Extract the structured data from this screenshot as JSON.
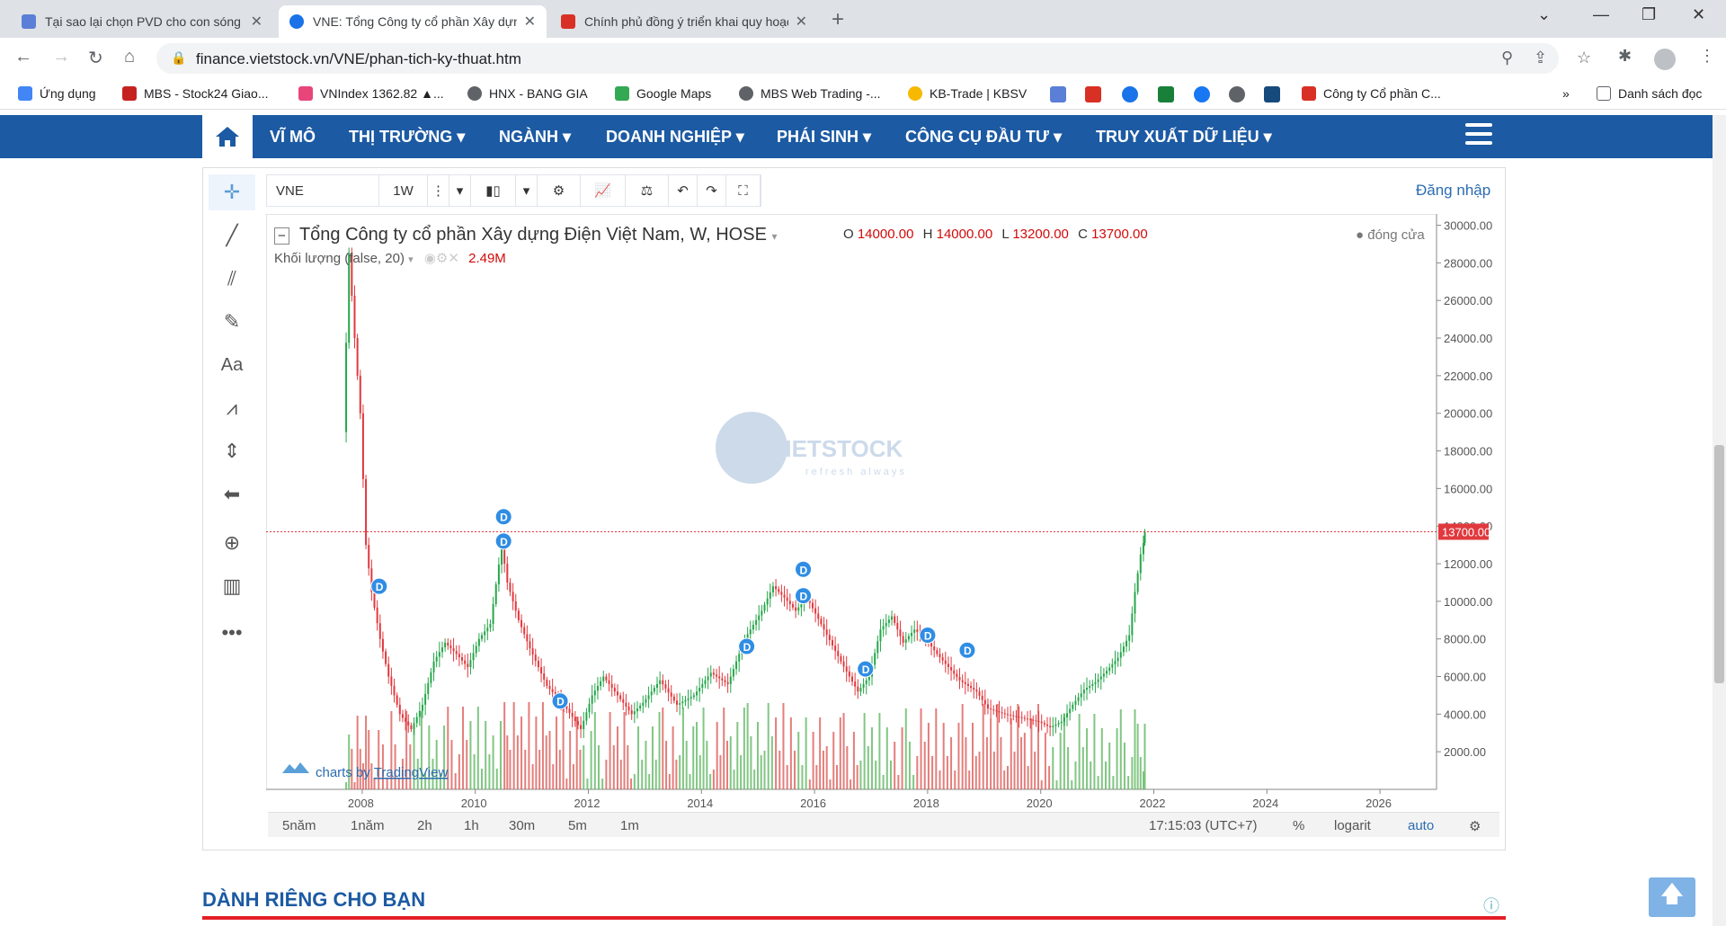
{
  "browser": {
    "tabs": [
      {
        "title": "Tại sao lại chọn PVD cho con sóng",
        "color": "#5b7fd6"
      },
      {
        "title": "VNE: Tổng Công ty cổ phần Xây dựng",
        "color": "#1a73e8",
        "active": true
      },
      {
        "title": "Chính phủ đồng ý triển khai quy hoạch",
        "color": "#d93025"
      }
    ],
    "url": "finance.vietstock.vn/VNE/phan-tich-ky-thuat.htm",
    "bookmarks": [
      {
        "label": "Ứng dụng",
        "color": "#4285f4"
      },
      {
        "label": "MBS - Stock24 Giao...",
        "color": "#c5221f"
      },
      {
        "label": "VNIndex 1362.82 ▲...",
        "color": "#e8457a"
      },
      {
        "label": "HNX - BANG GIA",
        "color": "#5f6368"
      },
      {
        "label": "Google Maps",
        "color": "#34a853"
      },
      {
        "label": "MBS Web Trading -...",
        "color": "#5f6368"
      },
      {
        "label": "KB-Trade | KBSV",
        "color": "#f6b900"
      },
      {
        "label": "Công ty Cổ phần C...",
        "color": "#d93025"
      }
    ],
    "bookmarks_more": "»",
    "reading_list": "Danh sách đọc"
  },
  "site_nav": {
    "items": [
      "VĨ MÔ",
      "THỊ TRƯỜNG",
      "NGÀNH",
      "DOANH NGHIỆP",
      "PHÁI SINH",
      "CÔNG CỤ ĐẦU TƯ",
      "TRUY XUẤT DỮ LIỆU"
    ],
    "dropdown": [
      false,
      true,
      true,
      true,
      true,
      true,
      true
    ]
  },
  "chart_toolbar": {
    "symbol": "VNE",
    "interval": "1W",
    "login": "Đăng nhập"
  },
  "legend": {
    "title": "Tổng Công ty cổ phần Xây dựng Điện Việt Nam, W, HOSE",
    "open_label": "O",
    "open": "14000.00",
    "high_label": "H",
    "high": "14000.00",
    "low_label": "L",
    "low": "13200.00",
    "close_label": "C",
    "close": "13700.00",
    "volume_label": "Khối lượng (false, 20)",
    "volume_value": "2.49M",
    "close_mode": "đóng cửa"
  },
  "watermark": {
    "brand": "VIETSTOCK",
    "tag": "refresh always"
  },
  "attribution": {
    "prefix": "charts by",
    "link": "TradingView"
  },
  "bottom_bar": {
    "ranges": [
      "5năm",
      "1năm",
      "2h",
      "1h",
      "30m",
      "5m",
      "1m"
    ],
    "time": "17:15:03 (UTC+7)",
    "percent": "%",
    "log": "logarit",
    "auto": "auto"
  },
  "section": {
    "title": "DÀNH RIÊNG CHO BẠN"
  },
  "chart_data": {
    "type": "candlestick",
    "x_ticks": [
      "2008",
      "2010",
      "2012",
      "2014",
      "2016",
      "2018",
      "2020",
      "2022",
      "2024",
      "2026"
    ],
    "y_ticks": [
      "30000.00",
      "28000.00",
      "26000.00",
      "24000.00",
      "22000.00",
      "20000.00",
      "18000.00",
      "16000.00",
      "14000.00",
      "12000.00",
      "10000.00",
      "8000.00",
      "6000.00",
      "4000.00",
      "2000.00"
    ],
    "xlim": [
      2006.3,
      2027.0
    ],
    "ylim": [
      0,
      30600
    ],
    "last_price": "13700.00",
    "series_close": [
      [
        2007.7,
        19000
      ],
      [
        2007.8,
        28500
      ],
      [
        2007.9,
        24000
      ],
      [
        2008.0,
        20000
      ],
      [
        2008.1,
        13000
      ],
      [
        2008.2,
        10500
      ],
      [
        2008.35,
        8000
      ],
      [
        2008.5,
        6000
      ],
      [
        2008.7,
        4000
      ],
      [
        2008.9,
        3200
      ],
      [
        2009.1,
        4500
      ],
      [
        2009.3,
        6800
      ],
      [
        2009.5,
        7800
      ],
      [
        2009.7,
        7200
      ],
      [
        2009.9,
        6500
      ],
      [
        2010.1,
        8000
      ],
      [
        2010.3,
        8800
      ],
      [
        2010.5,
        13000
      ],
      [
        2010.6,
        11000
      ],
      [
        2010.8,
        9000
      ],
      [
        2011.0,
        7500
      ],
      [
        2011.3,
        5500
      ],
      [
        2011.6,
        4500
      ],
      [
        2011.9,
        3200
      ],
      [
        2012.1,
        5000
      ],
      [
        2012.3,
        6000
      ],
      [
        2012.5,
        5200
      ],
      [
        2012.8,
        4000
      ],
      [
        2013.0,
        4600
      ],
      [
        2013.3,
        5800
      ],
      [
        2013.6,
        4500
      ],
      [
        2013.9,
        5000
      ],
      [
        2014.2,
        6200
      ],
      [
        2014.5,
        5600
      ],
      [
        2014.8,
        8000
      ],
      [
        2015.1,
        9500
      ],
      [
        2015.3,
        10800
      ],
      [
        2015.5,
        10200
      ],
      [
        2015.7,
        9500
      ],
      [
        2015.9,
        10200
      ],
      [
        2016.2,
        8500
      ],
      [
        2016.5,
        6800
      ],
      [
        2016.8,
        5200
      ],
      [
        2017.0,
        6000
      ],
      [
        2017.2,
        8500
      ],
      [
        2017.4,
        9200
      ],
      [
        2017.6,
        7800
      ],
      [
        2017.8,
        8500
      ],
      [
        2018.0,
        8000
      ],
      [
        2018.2,
        7200
      ],
      [
        2018.4,
        6500
      ],
      [
        2018.6,
        5800
      ],
      [
        2018.9,
        5200
      ],
      [
        2019.1,
        4300
      ],
      [
        2019.4,
        4000
      ],
      [
        2019.7,
        3800
      ],
      [
        2020.0,
        3600
      ],
      [
        2020.2,
        3300
      ],
      [
        2020.4,
        3600
      ],
      [
        2020.6,
        4500
      ],
      [
        2020.8,
        5300
      ],
      [
        2021.0,
        5700
      ],
      [
        2021.2,
        6300
      ],
      [
        2021.4,
        7000
      ],
      [
        2021.6,
        8200
      ],
      [
        2021.7,
        10500
      ],
      [
        2021.8,
        12500
      ],
      [
        2021.85,
        13700
      ]
    ],
    "dividend_markers": [
      [
        2008.3,
        10800
      ],
      [
        2010.5,
        14500
      ],
      [
        2010.5,
        13200
      ],
      [
        2011.5,
        4700
      ],
      [
        2014.8,
        7600
      ],
      [
        2015.8,
        11700
      ],
      [
        2015.8,
        10300
      ],
      [
        2016.9,
        6400
      ],
      [
        2018.0,
        8200
      ],
      [
        2018.7,
        7400
      ]
    ],
    "marker_label": "D"
  }
}
